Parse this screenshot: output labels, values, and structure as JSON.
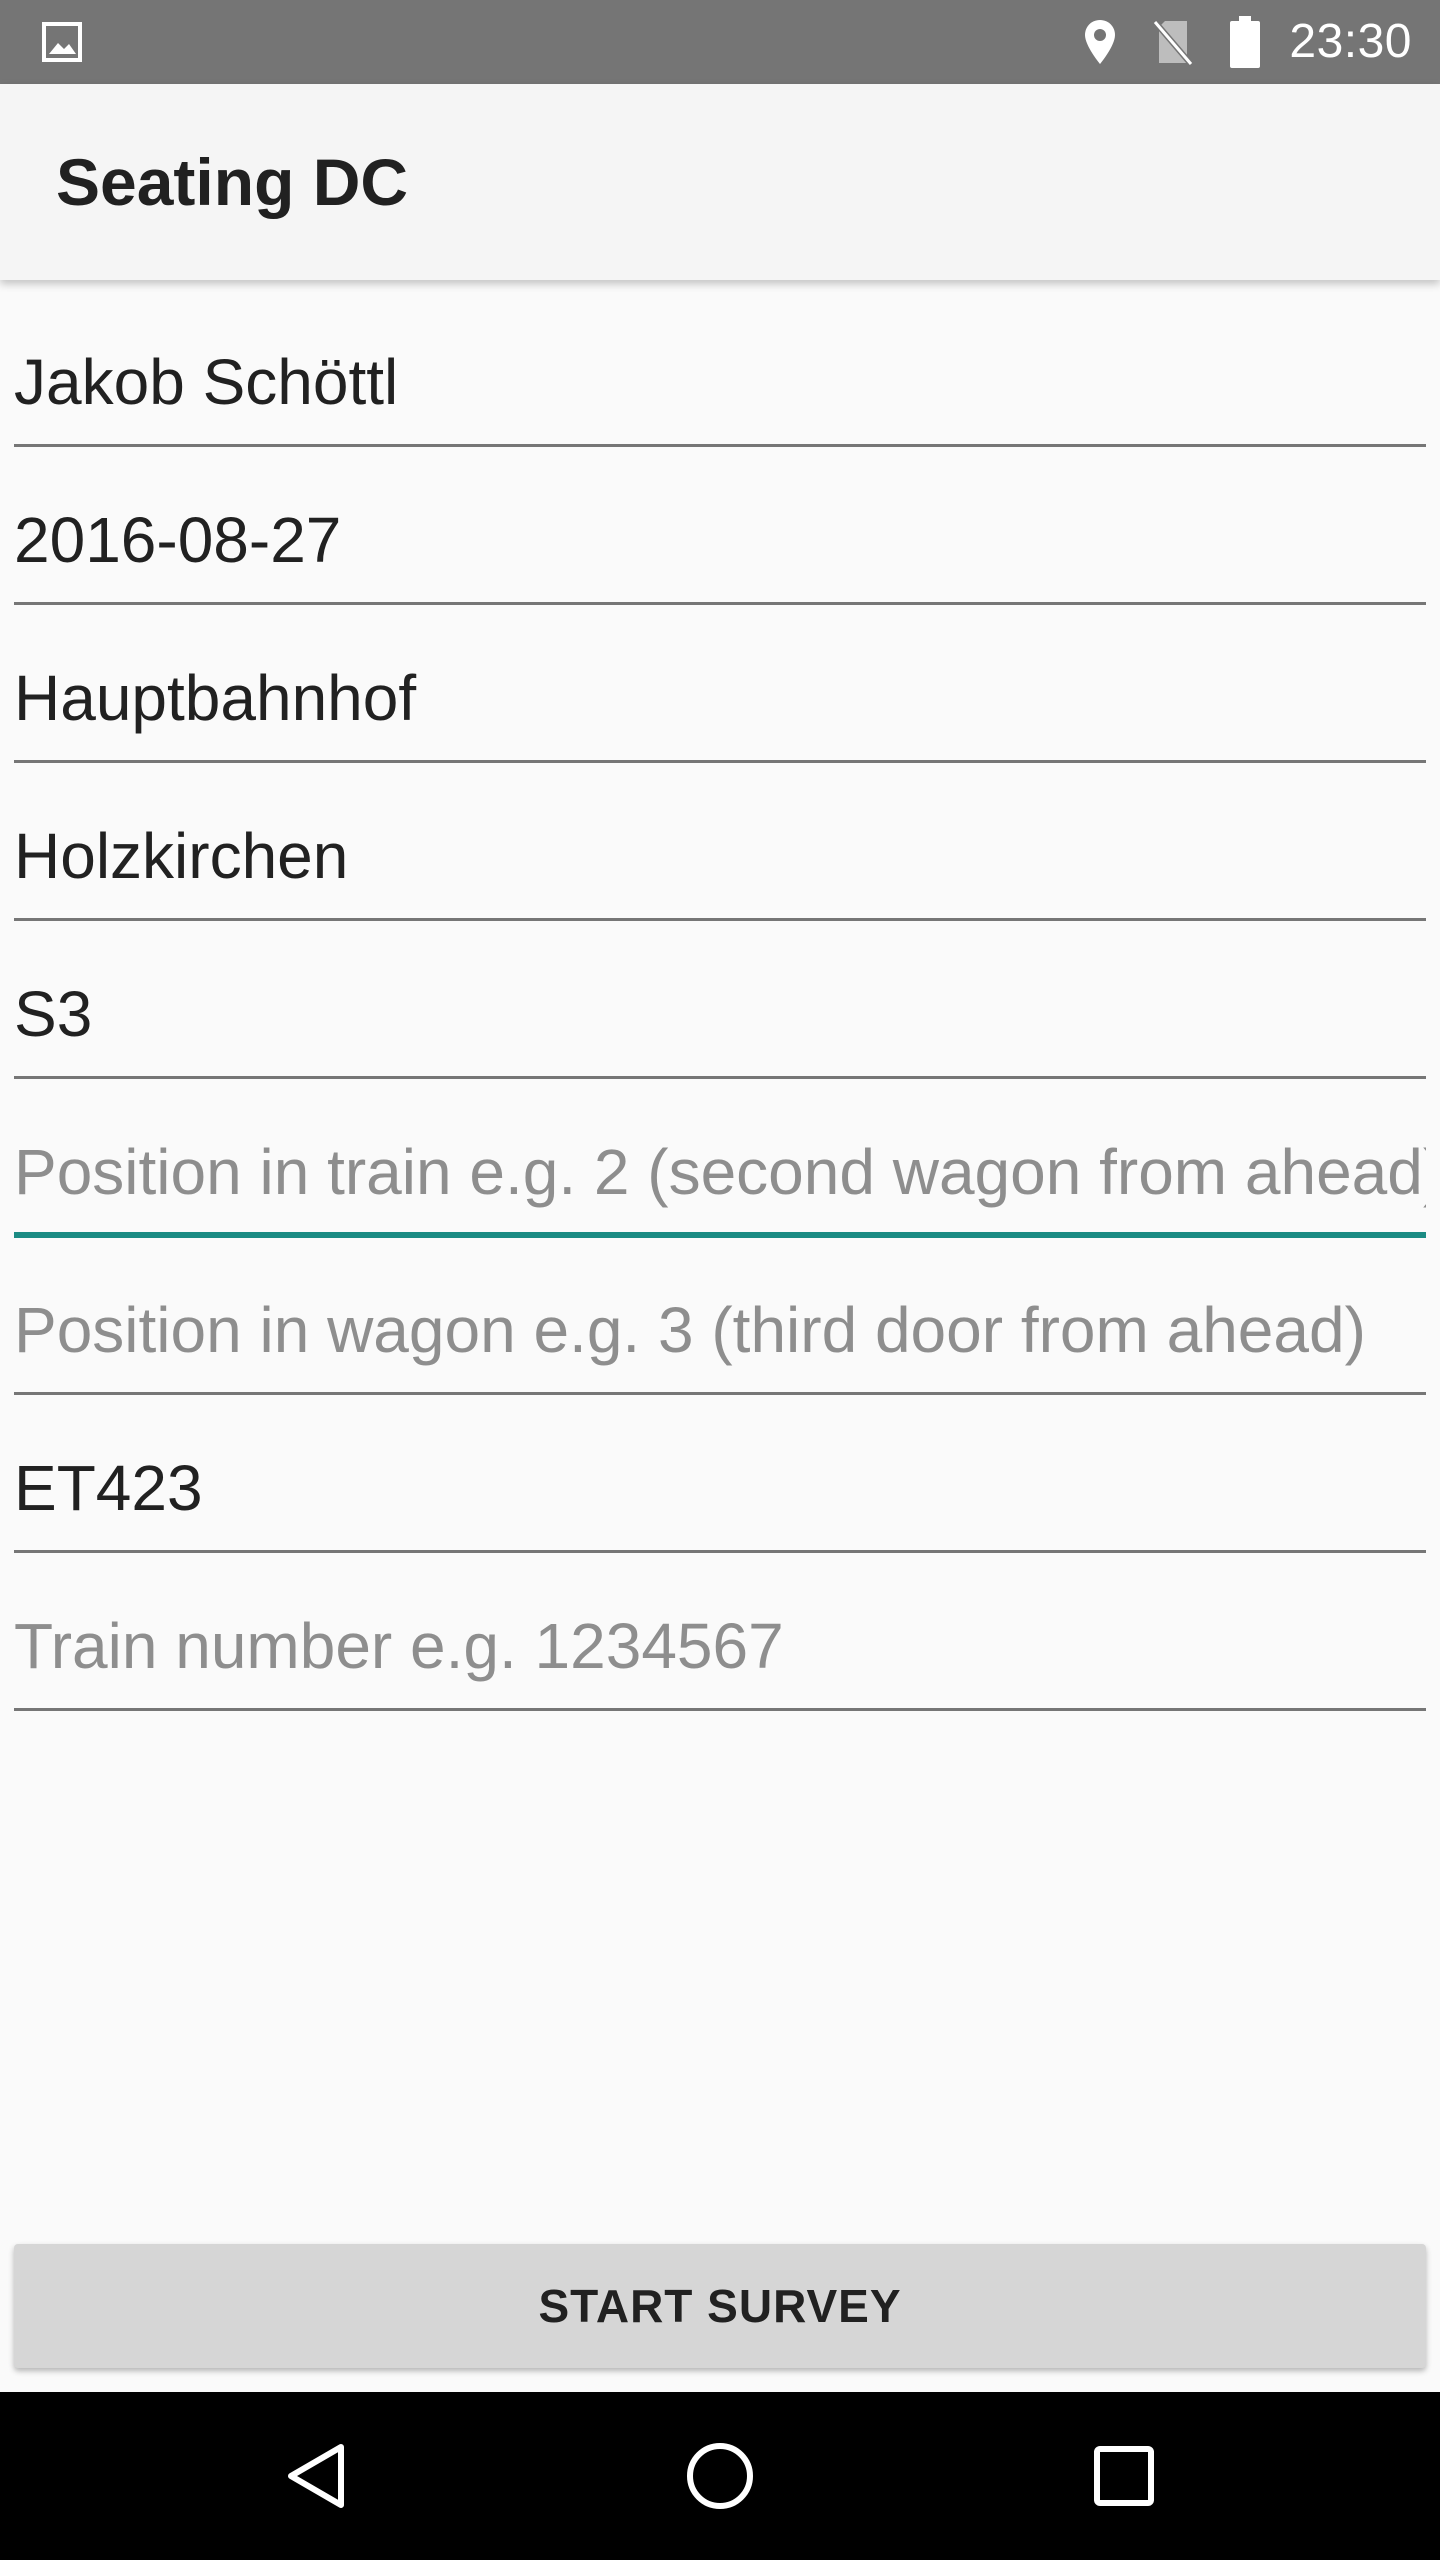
{
  "status_bar": {
    "time": "23:30",
    "icons": [
      "image-icon",
      "location-icon",
      "no-sim-icon",
      "battery-icon"
    ]
  },
  "app_bar": {
    "title": "Seating DC"
  },
  "form": {
    "fields": [
      {
        "value": "Jakob Schöttl",
        "placeholder": ""
      },
      {
        "value": "2016-08-27",
        "placeholder": ""
      },
      {
        "value": "Hauptbahnhof",
        "placeholder": ""
      },
      {
        "value": "Holzkirchen",
        "placeholder": ""
      },
      {
        "value": "S3",
        "placeholder": ""
      },
      {
        "value": "",
        "placeholder": "Position in train e.g. 2 (second wagon from ahead)",
        "focused": true
      },
      {
        "value": "",
        "placeholder": "Position in wagon e.g. 3 (third door from ahead)"
      },
      {
        "value": "ET423",
        "placeholder": ""
      },
      {
        "value": "",
        "placeholder": "Train number e.g. 1234567"
      }
    ]
  },
  "button": {
    "label": "START SURVEY"
  },
  "nav_bar": {
    "buttons": [
      "back-icon",
      "home-icon",
      "recents-icon"
    ]
  },
  "colors": {
    "status_bar": "#757575",
    "app_bar": "#f5f5f5",
    "background": "#fafafa",
    "accent": "#1b8b83",
    "button": "#d6d6d6",
    "nav_bar": "#000000"
  }
}
